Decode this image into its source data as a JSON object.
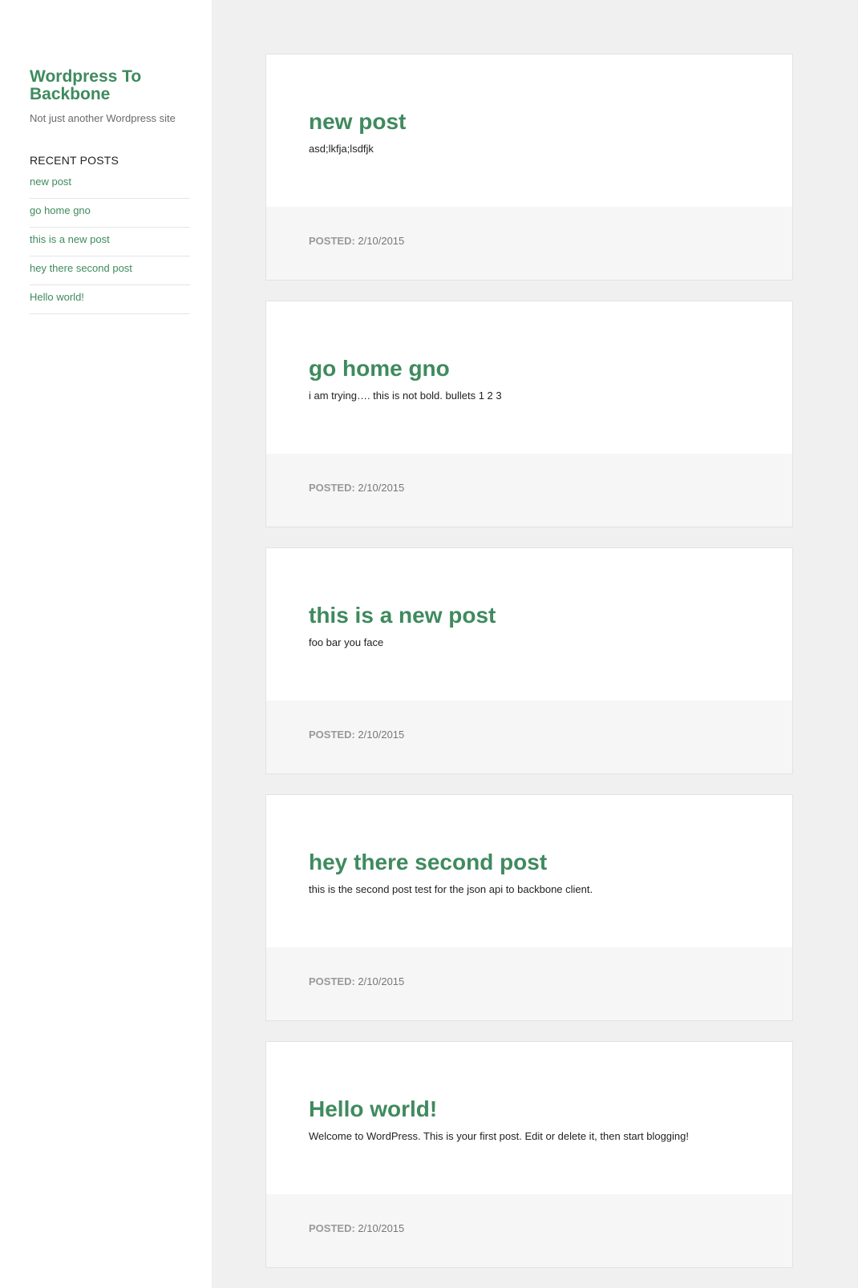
{
  "site": {
    "title": "Wordpress To Backbone",
    "description": "Not just another Wordpress site"
  },
  "sidebar": {
    "widget_title": "RECENT POSTS",
    "recent_posts": [
      {
        "label": "new post"
      },
      {
        "label": "go home gno"
      },
      {
        "label": "this is a new post"
      },
      {
        "label": "hey there second post"
      },
      {
        "label": "Hello world!"
      }
    ]
  },
  "colors": {
    "accent": "#3f8a5e",
    "page_background": "#f0f0f0",
    "card_footer_background": "#f6f6f6"
  },
  "posts": [
    {
      "title": "new post",
      "excerpt": "asd;lkfja;lsdfjk",
      "posted_label": "POSTED:",
      "date": "2/10/2015"
    },
    {
      "title": "go home gno",
      "excerpt": "i am trying…. this is not bold. bullets 1 2 3",
      "posted_label": "POSTED:",
      "date": "2/10/2015"
    },
    {
      "title": "this is a new post",
      "excerpt": "foo bar you face",
      "posted_label": "POSTED:",
      "date": "2/10/2015"
    },
    {
      "title": "hey there second post",
      "excerpt": "this is the second post test for the json api to backbone client.",
      "posted_label": "POSTED:",
      "date": "2/10/2015"
    },
    {
      "title": "Hello world!",
      "excerpt": "Welcome to WordPress. This is your first post. Edit or delete it, then start blogging!",
      "posted_label": "POSTED:",
      "date": "2/10/2015"
    }
  ]
}
